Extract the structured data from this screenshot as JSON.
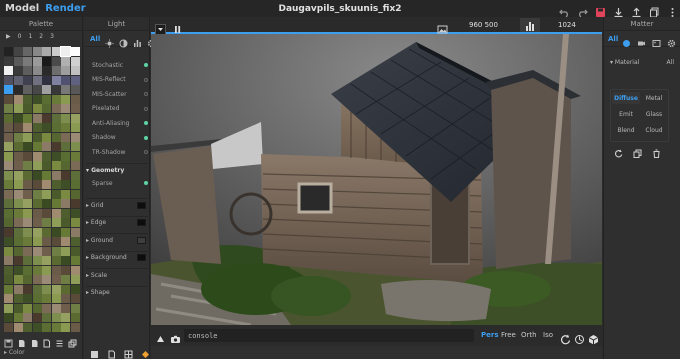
{
  "topbar": {
    "mode_model": "Model",
    "mode_render": "Render",
    "title": "Daugavpils_skuunis_fix2",
    "icons": [
      "undo-icon",
      "redo-icon",
      "save-icon",
      "download-icon",
      "upload-icon",
      "copy-icon",
      "menu-icon"
    ]
  },
  "palette": {
    "header": "Palette",
    "tabs": [
      "▶",
      "0",
      "1",
      "2",
      "3"
    ],
    "footer_label": "Color",
    "accent": "#3d9ef0"
  },
  "light": {
    "header": "Light",
    "tab_all": "All",
    "options": [
      {
        "label": "Stochastic",
        "on": true
      },
      {
        "label": "MIS-Reflect",
        "on": false
      },
      {
        "label": "MIS-Scatter",
        "on": false
      },
      {
        "label": "Pixelated",
        "on": false
      },
      {
        "label": "Anti-Aliasing",
        "on": true
      },
      {
        "label": "Shadow",
        "on": true
      },
      {
        "label": "TR-Shadow",
        "on": false
      }
    ],
    "geometry_header": "Geometry",
    "sparse_label": "Sparse",
    "sections": [
      {
        "label": "Grid",
        "swatch": "black"
      },
      {
        "label": "Edge",
        "swatch": "black"
      },
      {
        "label": "Ground",
        "swatch": "grey"
      },
      {
        "label": "Background",
        "swatch": "black"
      },
      {
        "label": "Scale",
        "swatch": "none"
      },
      {
        "label": "Shape",
        "swatch": "none"
      }
    ]
  },
  "viewport": {
    "resolution": "960  500",
    "samples": "1024",
    "console_text": "console",
    "view_modes": [
      "Pers",
      "Free",
      "Orth",
      "Iso"
    ],
    "active_view_mode": "Pers"
  },
  "matter": {
    "header": "Matter",
    "tab_all": "All",
    "material_label": "Material",
    "material_all": "All",
    "materials": [
      {
        "label": "Diffuse",
        "on": true
      },
      {
        "label": "Metal",
        "on": false
      },
      {
        "label": "Emit",
        "on": false
      },
      {
        "label": "Glass",
        "on": false
      },
      {
        "label": "Blend",
        "on": false
      },
      {
        "label": "Cloud",
        "on": false
      }
    ]
  }
}
